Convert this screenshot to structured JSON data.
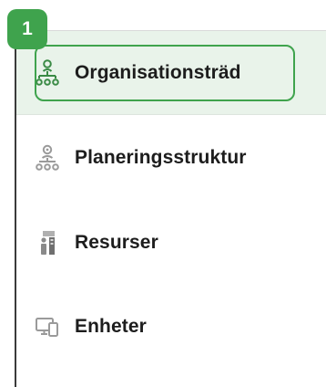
{
  "callout": {
    "step_number": "1"
  },
  "nav": {
    "items": [
      {
        "label": "Organisationsträd",
        "icon": "org-tree-icon",
        "active": true
      },
      {
        "label": "Planeringsstruktur",
        "icon": "planning-structure-icon",
        "active": false
      },
      {
        "label": "Resurser",
        "icon": "resources-icon",
        "active": false
      },
      {
        "label": "Enheter",
        "icon": "devices-icon",
        "active": false
      }
    ]
  },
  "colors": {
    "accent_green": "#3fa34d",
    "active_background": "#e9f3ea",
    "active_icon": "#3a8a45",
    "inactive_icon": "#9a9a9a",
    "text": "#1d1d1d"
  }
}
